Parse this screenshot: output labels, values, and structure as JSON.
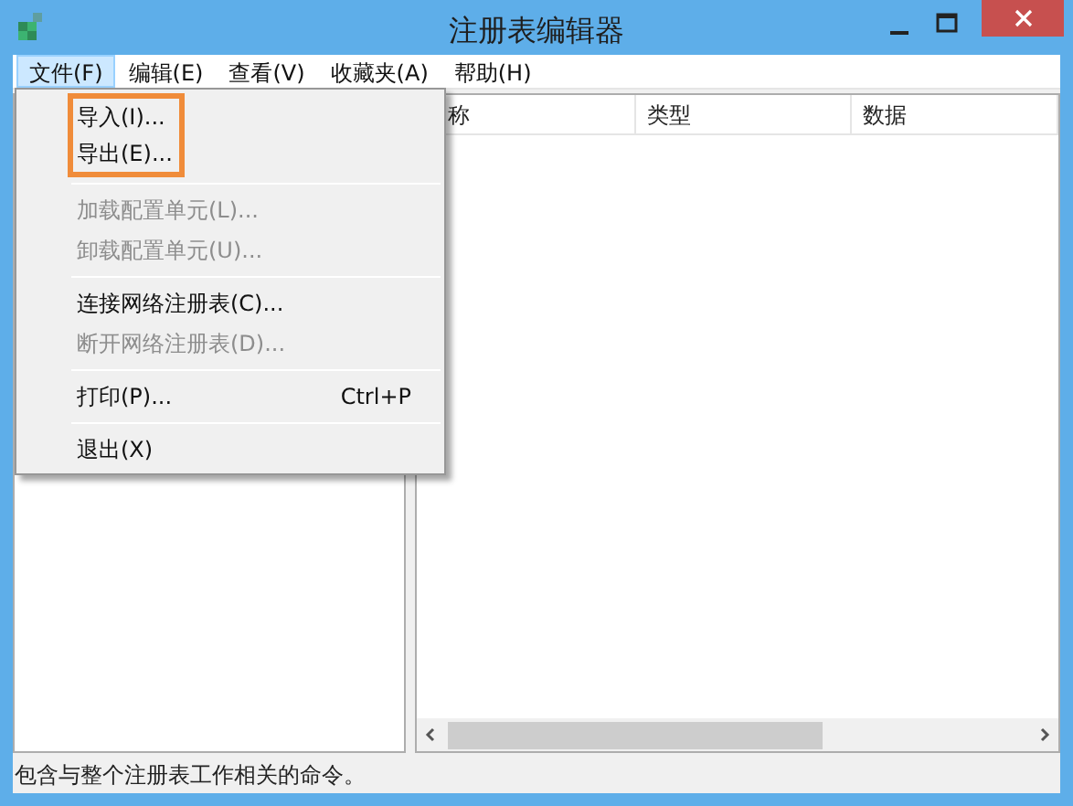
{
  "window": {
    "title": "注册表编辑器"
  },
  "menu_bar": [
    {
      "label": "文件(F)",
      "selected": true
    },
    {
      "label": "编辑(E)",
      "selected": false
    },
    {
      "label": "查看(V)",
      "selected": false
    },
    {
      "label": "收藏夹(A)",
      "selected": false
    },
    {
      "label": "帮助(H)",
      "selected": false
    }
  ],
  "file_menu": {
    "items": [
      {
        "kind": "item",
        "label": "导入(I)...",
        "disabled": false,
        "highlighted": true
      },
      {
        "kind": "item",
        "label": "导出(E)...",
        "disabled": false,
        "highlighted": true
      },
      {
        "kind": "separator"
      },
      {
        "kind": "item",
        "label": "加载配置单元(L)...",
        "disabled": true,
        "highlighted": false
      },
      {
        "kind": "item",
        "label": "卸载配置单元(U)...",
        "disabled": true,
        "highlighted": false
      },
      {
        "kind": "separator"
      },
      {
        "kind": "item",
        "label": "连接网络注册表(C)...",
        "disabled": false,
        "highlighted": false
      },
      {
        "kind": "item",
        "label": "断开网络注册表(D)...",
        "disabled": true,
        "highlighted": false
      },
      {
        "kind": "separator"
      },
      {
        "kind": "item",
        "label": "打印(P)...",
        "shortcut": "Ctrl+P",
        "disabled": false,
        "highlighted": false
      },
      {
        "kind": "separator"
      },
      {
        "kind": "item",
        "label": "退出(X)",
        "disabled": false,
        "highlighted": false
      }
    ]
  },
  "list": {
    "columns": [
      "称",
      "类型",
      "数据"
    ]
  },
  "status_bar": "包含与整个注册表工作相关的命令。"
}
